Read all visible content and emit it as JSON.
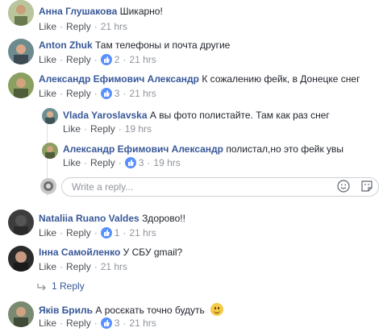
{
  "comments": [
    {
      "author": "Анна Глушакова",
      "text": "Шикарно!",
      "like": "Like",
      "reply": "Reply",
      "likes": "",
      "time": "21 hrs"
    },
    {
      "author": "Anton Zhuk",
      "text": "Там телефоны и почта другие",
      "like": "Like",
      "reply": "Reply",
      "likes": "2",
      "time": "21 hrs"
    },
    {
      "author": "Александр Ефимович Александр",
      "text": "К сожалению фейк, в Донецке снег",
      "like": "Like",
      "reply": "Reply",
      "likes": "3",
      "time": "21 hrs"
    },
    {
      "author": "Vlada Yaroslavska",
      "text": "А вы фото полистайте. Там как раз снег",
      "like": "Like",
      "reply": "Reply",
      "likes": "",
      "time": "19 hrs"
    },
    {
      "author": "Александр Ефимович Александр",
      "text": "полистал,но это фейк увы",
      "like": "Like",
      "reply": "Reply",
      "likes": "3",
      "time": "19 hrs"
    },
    {
      "author": "Nataliia Ruano Valdes",
      "text": "Здорово!!",
      "like": "Like",
      "reply": "Reply",
      "likes": "1",
      "time": "21 hrs"
    },
    {
      "author": "Інна Самойленко",
      "text": "У СБУ gmail?",
      "like": "Like",
      "reply": "Reply",
      "likes": "",
      "time": "21 hrs"
    },
    {
      "author": "Яків Бриль",
      "text": "А росєкать точно будуть",
      "like": "Like",
      "reply": "Reply",
      "likes": "3",
      "time": "21 hrs"
    }
  ],
  "reply_box": {
    "placeholder": "Write a reply..."
  },
  "more_replies": "1 Reply",
  "colors": {
    "author": "#385898",
    "meta": "#90949c",
    "like_badge": "#5890ff"
  }
}
